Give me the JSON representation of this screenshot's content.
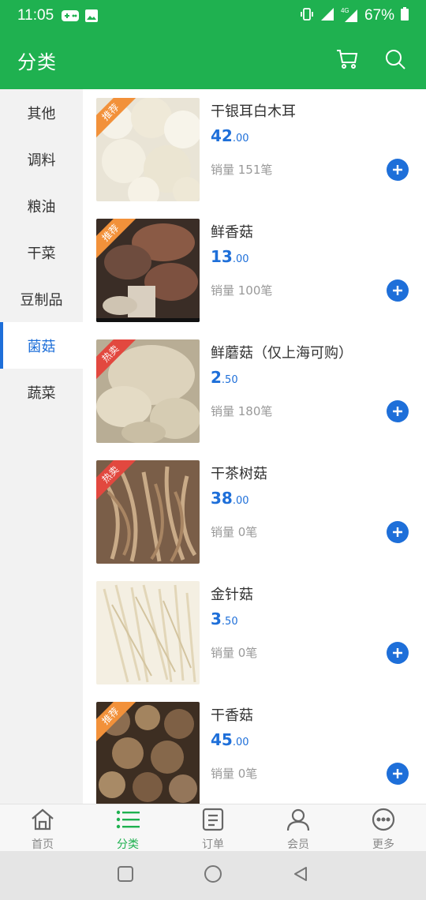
{
  "status_bar": {
    "time": "11:05",
    "battery_percent": "67%",
    "network": "4G"
  },
  "app_bar": {
    "title": "分类",
    "cart_icon": "cart-icon",
    "search_icon": "search-icon"
  },
  "colors": {
    "brand_green": "#1fb150",
    "accent_blue": "#1e6fd9",
    "ribbon_recommend": "#f2913a",
    "ribbon_hot": "#e2483f"
  },
  "sidebar": {
    "active_index": 5,
    "items": [
      {
        "label": "其他"
      },
      {
        "label": "调料"
      },
      {
        "label": "粮油"
      },
      {
        "label": "干菜"
      },
      {
        "label": "豆制品"
      },
      {
        "label": "菌菇"
      },
      {
        "label": "蔬菜"
      }
    ]
  },
  "products": [
    {
      "name": "干银耳白木耳",
      "price_int": "42",
      "price_dec": ".00",
      "sales": "销量 151笔",
      "badge": "推荐",
      "badge_type": "recommend"
    },
    {
      "name": "鲜香菇",
      "price_int": "13",
      "price_dec": ".00",
      "sales": "销量 100笔",
      "badge": "推荐",
      "badge_type": "recommend"
    },
    {
      "name": "鲜蘑菇（仅上海可购）",
      "price_int": "2",
      "price_dec": ".50",
      "sales": "销量 180笔",
      "badge": "热卖",
      "badge_type": "hot"
    },
    {
      "name": "干茶树菇",
      "price_int": "38",
      "price_dec": ".00",
      "sales": "销量 0笔",
      "badge": "热卖",
      "badge_type": "hot"
    },
    {
      "name": "金针菇",
      "price_int": "3",
      "price_dec": ".50",
      "sales": "销量 0笔",
      "badge": "",
      "badge_type": ""
    },
    {
      "name": "干香菇",
      "price_int": "45",
      "price_dec": ".00",
      "sales": "销量 0笔",
      "badge": "推荐",
      "badge_type": "recommend"
    }
  ],
  "bottom_nav": {
    "active_index": 1,
    "items": [
      {
        "label": "首页",
        "icon": "home-icon"
      },
      {
        "label": "分类",
        "icon": "category-list-icon"
      },
      {
        "label": "订单",
        "icon": "order-list-icon"
      },
      {
        "label": "会员",
        "icon": "user-icon"
      },
      {
        "label": "更多",
        "icon": "more-icon"
      }
    ]
  },
  "system_nav": {
    "icons": [
      "recents-square-icon",
      "home-circle-icon",
      "back-triangle-icon"
    ]
  }
}
